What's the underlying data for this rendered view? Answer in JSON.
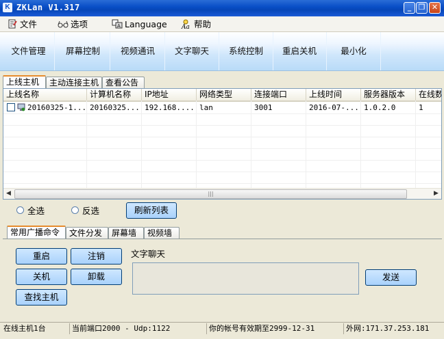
{
  "window": {
    "title": "ZKLan V1.317",
    "logo": "K"
  },
  "menus": [
    "文件",
    "选项",
    "Language",
    "帮助"
  ],
  "toolbar": [
    "文件管理",
    "屏幕控制",
    "视频通讯",
    "文字聊天",
    "系统控制",
    "重启关机",
    "最小化"
  ],
  "host_tabs": [
    "上线主机",
    "主动连接主机",
    "查看公告"
  ],
  "table": {
    "headers": [
      "上线名称",
      "计算机名称",
      "IP地址",
      "网络类型",
      "连接端口",
      "上线时间",
      "服务器版本",
      "在线数"
    ],
    "rows": [
      [
        "20160325-1...",
        "20160325...",
        "192.168....",
        "lan",
        "3001",
        "2016-07-...",
        "1.0.2.0",
        "1"
      ]
    ]
  },
  "select": {
    "all": "全选",
    "invert": "反选",
    "refresh": "刷新列表"
  },
  "cmd_tabs": [
    "常用广播命令",
    "文件分发",
    "屏幕墙",
    "视频墙"
  ],
  "commands": {
    "restart": "重启",
    "logout": "注销",
    "shutdown": "关机",
    "uninstall": "卸载",
    "find": "查找主机"
  },
  "chat": {
    "label": "文字聊天",
    "send": "发送"
  },
  "status": {
    "online": "在线主机1台",
    "port": "当前端口2000 - Udp:1122",
    "expiry": "你的帐号有效期至2999-12-31",
    "ip": "外网:171.37.253.181"
  },
  "colors": {
    "titlebar": "#0a4fc7",
    "active_tab_accent": "#e68b2c",
    "button": "#a9d2fb"
  }
}
